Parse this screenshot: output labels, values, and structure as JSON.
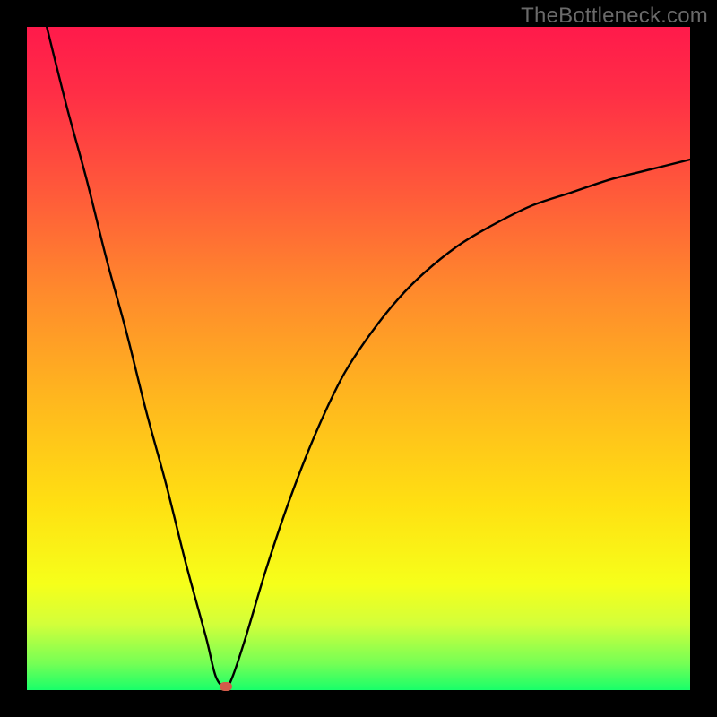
{
  "watermark": "TheBottleneck.com",
  "colors": {
    "gradient_top": "#ff1a4b",
    "gradient_mid1": "#ff8a2c",
    "gradient_mid2": "#ffe012",
    "gradient_bottom": "#18ff6a",
    "curve_stroke": "#000000",
    "marker_fill": "#d35b4a",
    "frame": "#000000"
  },
  "chart_data": {
    "type": "line",
    "title": "",
    "xlabel": "",
    "ylabel": "",
    "xlim": [
      0,
      100
    ],
    "ylim": [
      0,
      100
    ],
    "x": [
      3,
      6,
      9,
      12,
      15,
      18,
      21,
      24,
      27,
      28.5,
      30,
      31,
      33,
      36,
      39,
      42,
      45,
      48,
      52,
      56,
      60,
      65,
      70,
      76,
      82,
      88,
      94,
      100
    ],
    "y": [
      100,
      88,
      77,
      65,
      54,
      42,
      31,
      19,
      8,
      2,
      0.5,
      2,
      8,
      18,
      27,
      35,
      42,
      48,
      54,
      59,
      63,
      67,
      70,
      73,
      75,
      77,
      78.5,
      80
    ],
    "marker": {
      "x": 30,
      "y": 0.5
    },
    "notes": "V-shaped bottleneck curve; minimum (optimal match) at x≈30. Left branch is near-linear descent from top-left; right branch rises with diminishing slope toward ~80% at right edge."
  }
}
